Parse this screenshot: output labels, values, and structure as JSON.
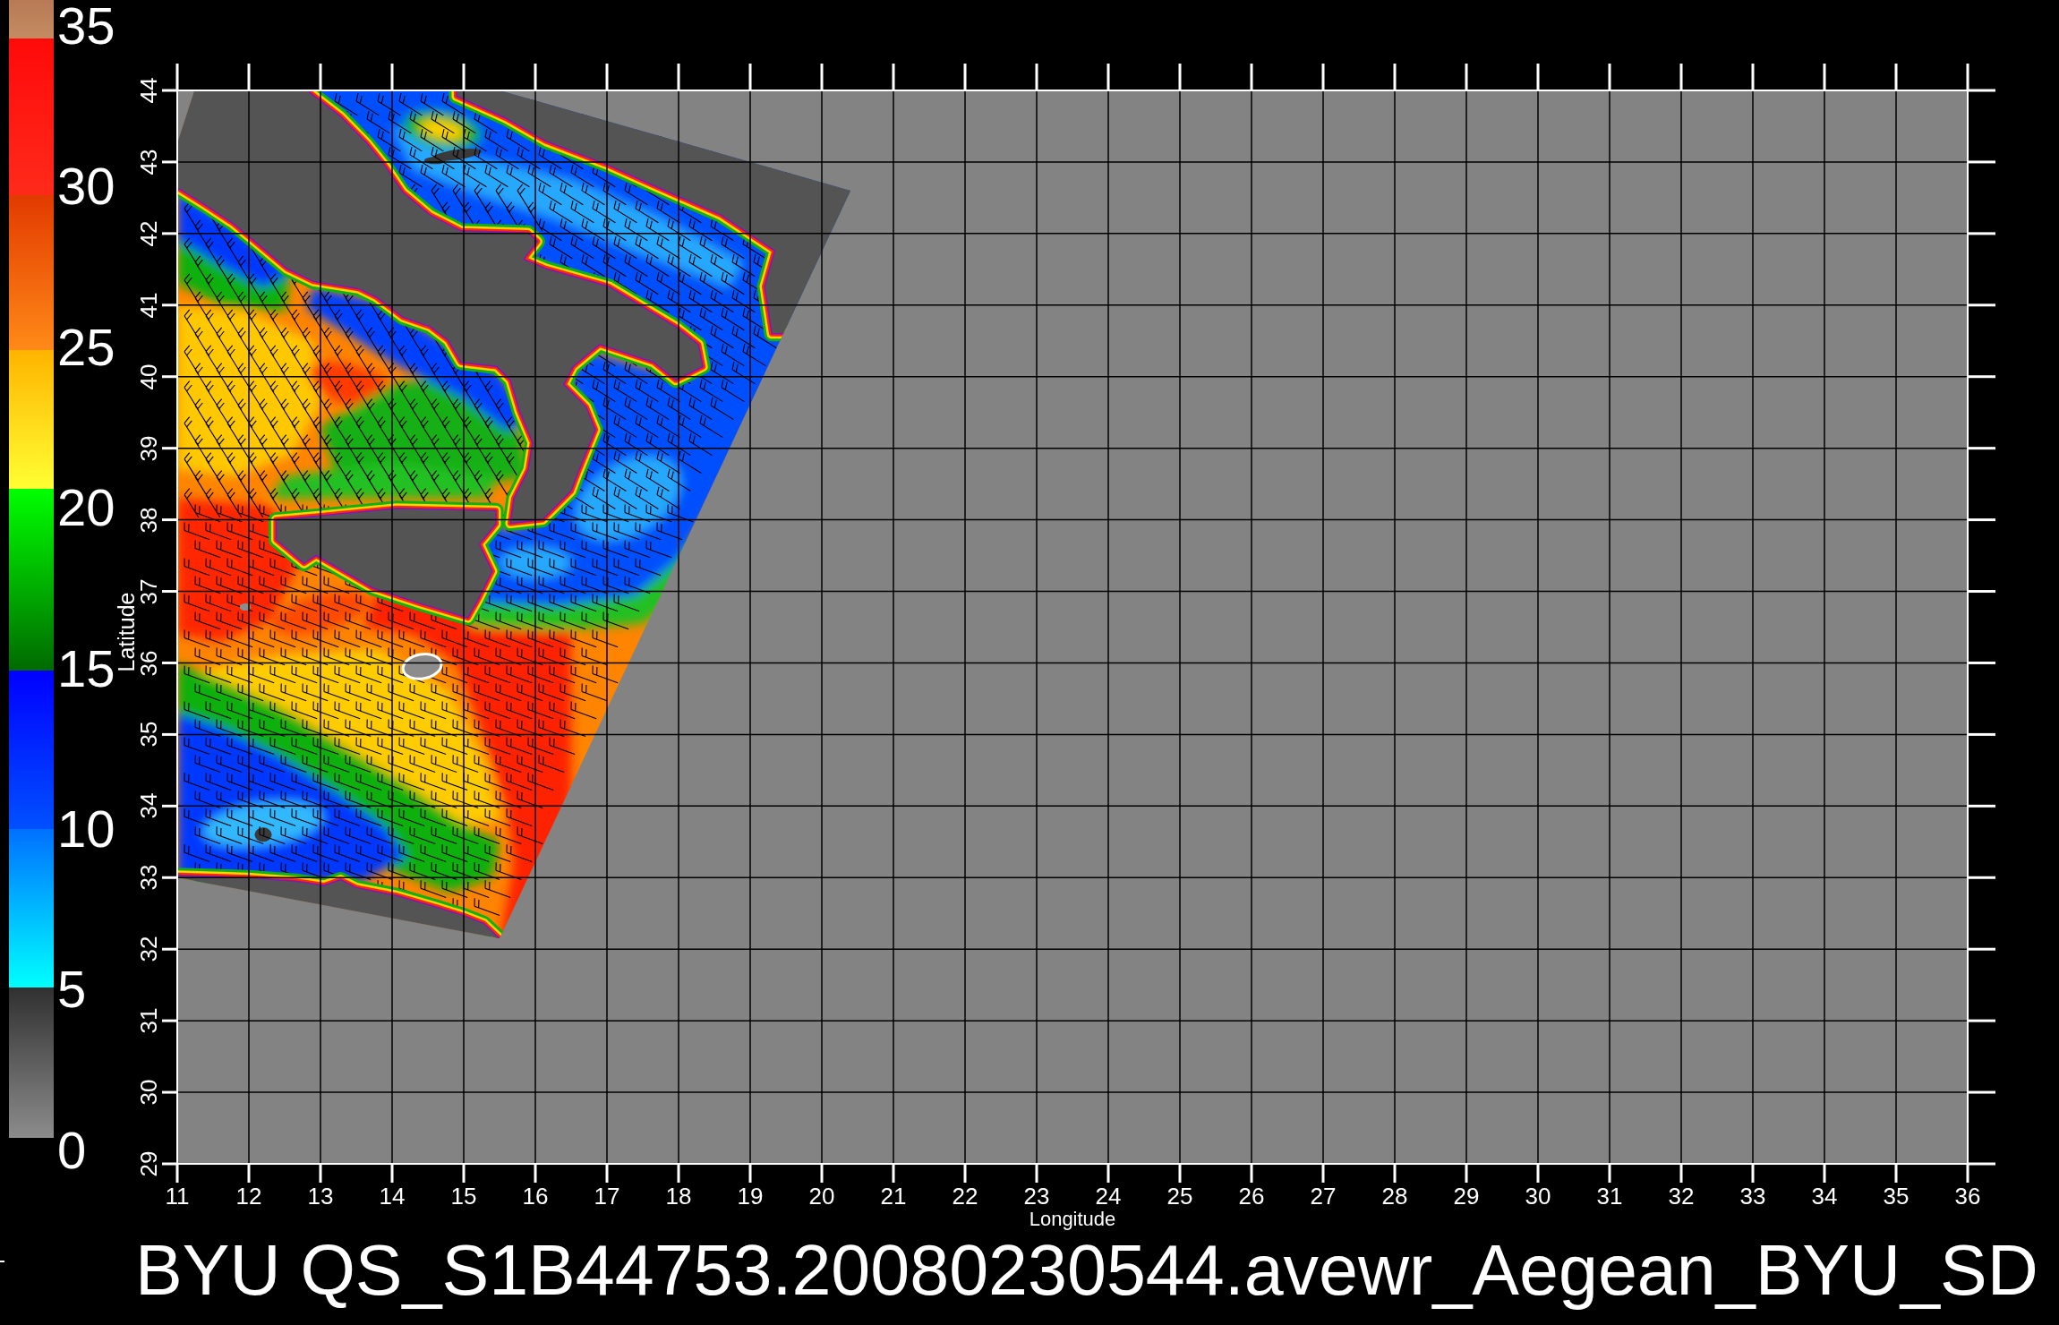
{
  "colorbar": {
    "labels": [
      "35",
      "30",
      "25",
      "20",
      "15",
      "10",
      "5",
      "0"
    ]
  },
  "map": {
    "ylabel": "Latitude",
    "y_ticks": [
      "44",
      "43",
      "42",
      "41",
      "40",
      "39",
      "38",
      "37",
      "36",
      "35",
      "34",
      "33",
      "32",
      "31",
      "30",
      "29"
    ],
    "xlabel": "Longitude",
    "x_ticks": [
      "11",
      "12",
      "13",
      "14",
      "15",
      "16",
      "17",
      "18",
      "19",
      "20",
      "21",
      "22",
      "23",
      "24",
      "25",
      "26",
      "27",
      "28",
      "29",
      "30",
      "31",
      "32",
      "33",
      "34",
      "35",
      "36"
    ]
  },
  "title": "BYU QS_S1B44753.20080230544.avewr_Aegean_BYU_SD"
}
